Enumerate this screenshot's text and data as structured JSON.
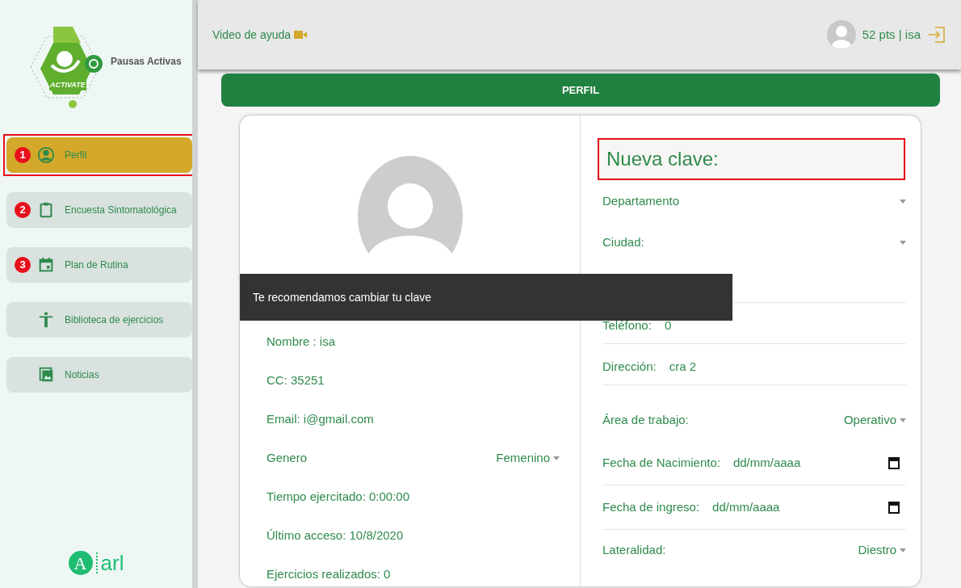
{
  "sidebar": {
    "logo": {
      "emblem_text": "ACTIVATE",
      "title": "Pausas Activas"
    },
    "items": [
      {
        "label": "Perfil",
        "selected": true,
        "badge": "1",
        "highlighted": true
      },
      {
        "label": "Encuesta Sintomatológica",
        "selected": false,
        "badge": "2",
        "highlighted": false
      },
      {
        "label": "Plan de Rutina",
        "selected": false,
        "badge": "3",
        "highlighted": false
      },
      {
        "label": "Biblioteca de ejercicios",
        "selected": false,
        "highlighted": false
      },
      {
        "label": "Noticias",
        "selected": false,
        "highlighted": false
      }
    ],
    "footer_logo": {
      "letter": "A",
      "text": "arl"
    }
  },
  "header": {
    "help_link": "Video de ayuda",
    "user": "52 pts | isa"
  },
  "page_title": "PERFIL",
  "profile": {
    "left_rows": [
      {
        "kind": "text",
        "text": "Nombre : isa"
      },
      {
        "kind": "text",
        "text": "CC: 35251"
      },
      {
        "kind": "text",
        "text": "Email: i@gmail.com"
      },
      {
        "kind": "select",
        "label": "Genero",
        "value": "Femenino"
      },
      {
        "kind": "text",
        "text": "Tiempo ejercitado: 0:00:00"
      },
      {
        "kind": "text",
        "text": "Último acceso: 10/8/2020"
      },
      {
        "kind": "text",
        "text": "Ejercicios realizados: 0"
      }
    ],
    "right_rows": [
      {
        "kind": "heading",
        "text": "Nueva clave:",
        "highlighted": true
      },
      {
        "kind": "select",
        "label": "Departamento"
      },
      {
        "kind": "select",
        "label": "Ciudad:"
      },
      {
        "kind": "blank"
      },
      {
        "kind": "text",
        "label": "Teléfono:",
        "value": "0"
      },
      {
        "kind": "text",
        "label": "Dirección:",
        "value": "cra 2"
      },
      {
        "kind": "select",
        "label": "Área de trabajo:",
        "value": "Operativo"
      },
      {
        "kind": "date",
        "label": "Fecha de Nacimiento:",
        "placeholder": "dd/mm/aaaa"
      },
      {
        "kind": "date",
        "label": "Fecha de ingreso:",
        "placeholder": "dd/mm/aaaa"
      },
      {
        "kind": "select",
        "label": "Lateralidad:",
        "value": "Diestro"
      }
    ]
  },
  "toast": {
    "text": "Te recomendamos cambiar tu clave"
  }
}
